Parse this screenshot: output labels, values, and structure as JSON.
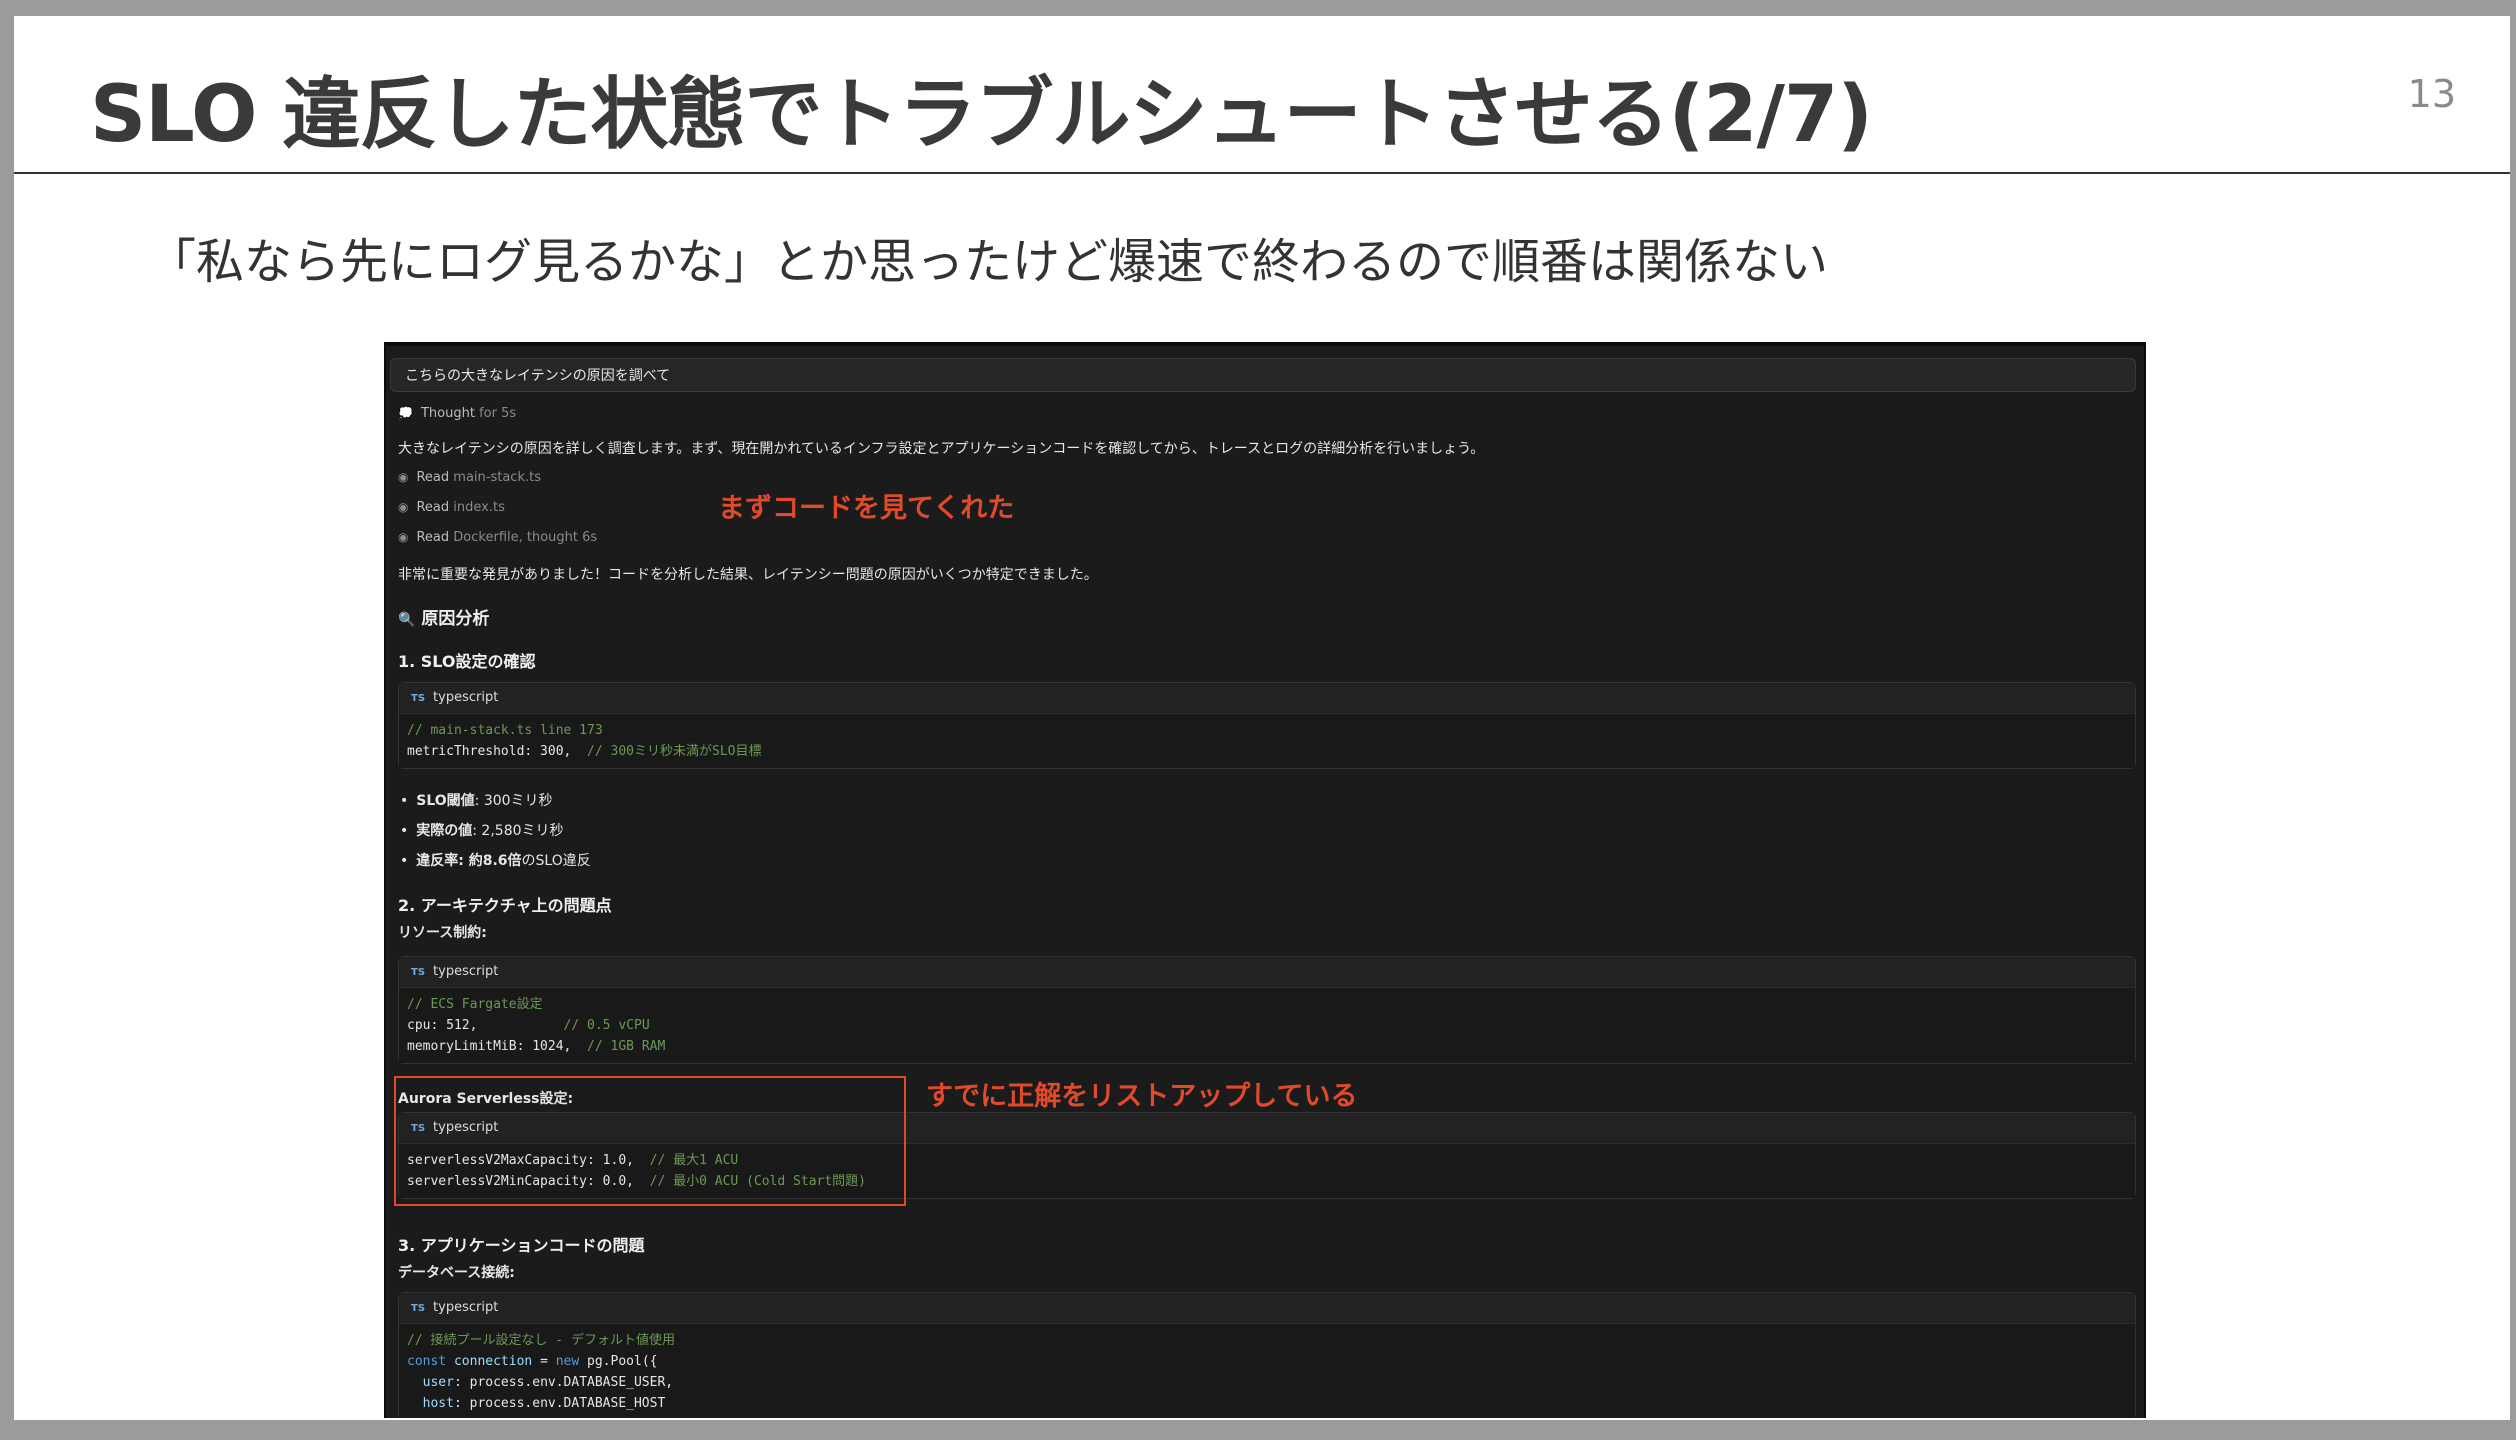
{
  "slide": {
    "title": "SLO 違反した状態でトラブルシュートさせる(2/7)",
    "page_number": "13",
    "subtitle": "「私なら先にログ見るかな」とか思ったけど爆速で終わるので順番は関係ない"
  },
  "annotations": {
    "first": "まずコードを見てくれた",
    "second": "すでに正解をリストアップしている"
  },
  "chat": {
    "prompt": "こちらの大きなレイテンシの原因を調べて",
    "thought_label": "Thought",
    "thought_time": "for 5s",
    "intro": "大きなレイテンシの原因を詳しく調査します。まず、現在開かれているインフラ設定とアプリケーションコードを確認してから、トレースとログの詳細分析を行いましょう。",
    "reads": [
      {
        "label": "Read",
        "file": "main-stack.ts"
      },
      {
        "label": "Read",
        "file": "index.ts"
      },
      {
        "label": "Read",
        "file": "Dockerfile, thought 6s"
      }
    ],
    "finding": "非常に重要な発見がありました！コードを分析した結果、レイテンシー問題の原因がいくつか特定できました。",
    "analysis_heading": "原因分析",
    "section1": "1. SLO設定の確認",
    "lang": "typescript",
    "ts_badge": "TS",
    "code1_line1": "// main-stack.ts line 173",
    "code1_line2_code": "metricThreshold: 300,",
    "code1_line2_comment": "// 300ミリ秒未満がSLO目標",
    "bullets": [
      {
        "key": "SLO閾値",
        "value": ": 300ミリ秒"
      },
      {
        "key": "実際の値",
        "value": ": 2,580ミリ秒"
      },
      {
        "key": "違反率",
        "value": ": 約8.6倍",
        "suffix": "のSLO違反"
      }
    ],
    "section2": "2. アーキテクチャ上の問題点",
    "resource_label": "リソース制約:",
    "code2_line1": "// ECS Fargate設定",
    "code2_line2_code": "cpu: 512,",
    "code2_line2_comment": "// 0.5 vCPU",
    "code2_line3_code": "memoryLimitMiB: 1024,",
    "code2_line3_comment": "// 1GB RAM",
    "aurora_label": "Aurora Serverless設定:",
    "code3_line1_code": "serverlessV2MaxCapacity: 1.0,",
    "code3_line1_comment": "// 最大1 ACU",
    "code3_line2_code": "serverlessV2MinCapacity: 0.0,",
    "code3_line2_comment": "// 最小0 ACU (Cold Start問題)",
    "section3": "3. アプリケーションコードの問題",
    "db_label": "データベース接続:",
    "code4_line1": "// 接続プール設定なし - デフォルト値使用",
    "code4_const": "const",
    "code4_var": "connection",
    "code4_eq": " = ",
    "code4_new": "new",
    "code4_call": " pg.Pool({",
    "code4_user_key": "user",
    "code4_user_val": "process.env.DATABASE_USER,",
    "code4_host_key": "host",
    "code4_host_val": "process.env.DATABASE_HOST"
  }
}
